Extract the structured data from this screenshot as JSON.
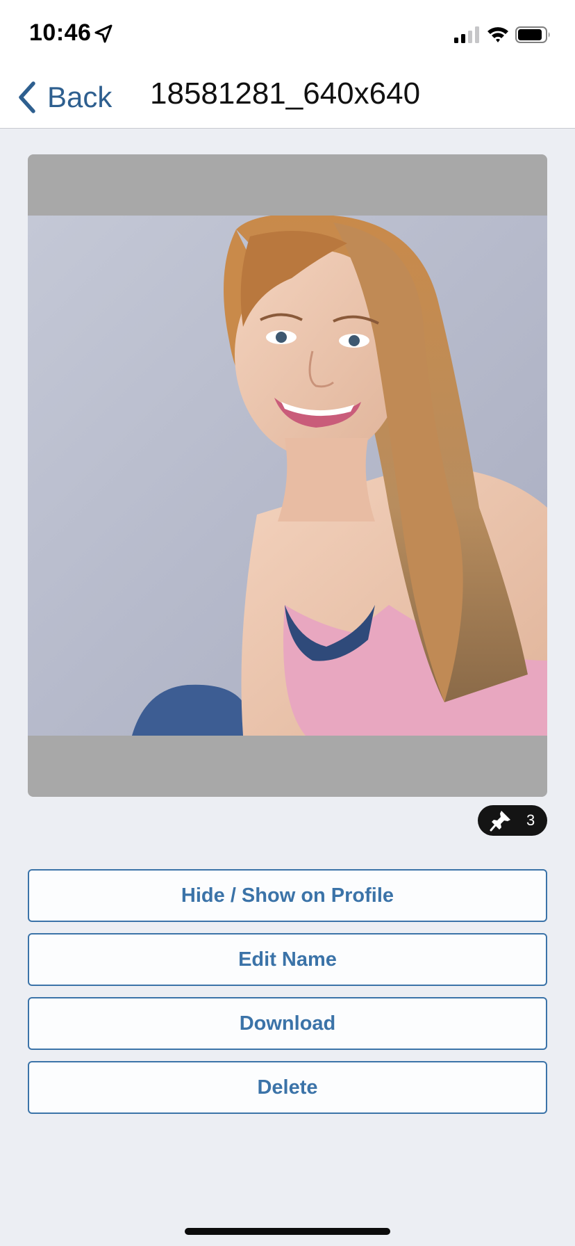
{
  "status_bar": {
    "time": "10:46",
    "location_icon": "location-arrow-icon",
    "signal_icon": "cellular-signal-icon",
    "wifi_icon": "wifi-icon",
    "battery_icon": "battery-icon"
  },
  "nav": {
    "back_label": "Back",
    "back_icon": "chevron-left-icon",
    "title": "18581281_640x640"
  },
  "photo": {
    "description_icon": "portrait-photo"
  },
  "pin_badge": {
    "icon": "pin-icon",
    "count": "3"
  },
  "actions": {
    "hide_show": "Hide / Show on Profile",
    "edit_name": "Edit Name",
    "download": "Download",
    "delete": "Delete"
  },
  "colors": {
    "accent": "#3b73a8",
    "back_label": "#2e5f8f",
    "background": "#eceef3",
    "photo_frame": "#a8a8a8",
    "badge": "#141414"
  }
}
